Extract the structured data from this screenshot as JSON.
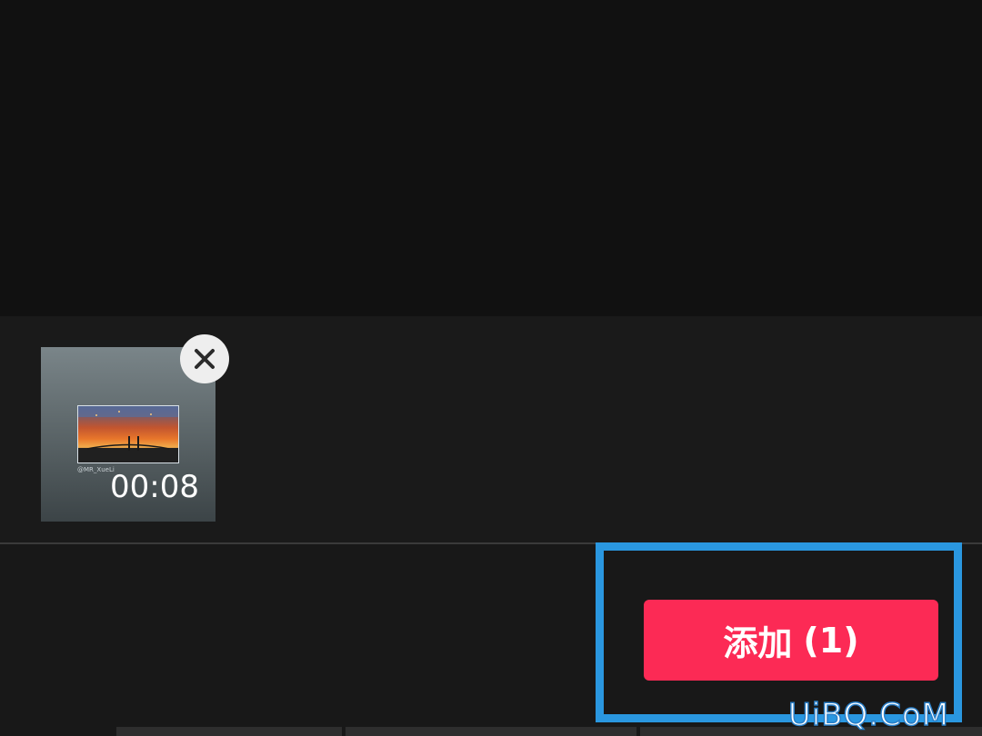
{
  "selected_clips": [
    {
      "duration": "00:08",
      "watermark": "@MR_XueLi",
      "thumbnail": "sunset-bridge-photo"
    }
  ],
  "remove_icon": "close-icon",
  "add_button": {
    "label": "添加",
    "count": "(1)"
  },
  "watermark_text": "UiBQ.CoM",
  "colors": {
    "accent": "#fc2a55",
    "highlight": "#2a97e0",
    "background": "#111111"
  }
}
